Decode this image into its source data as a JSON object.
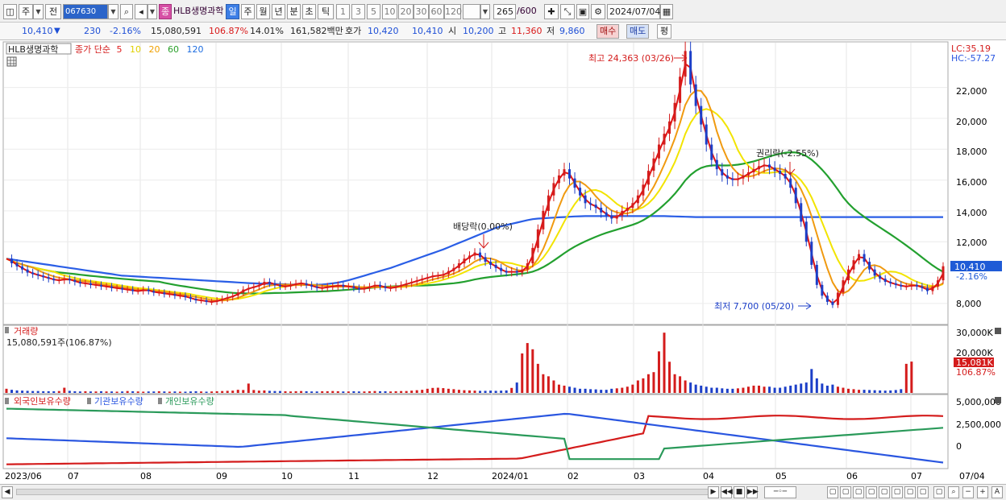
{
  "toolbar": {
    "period_btn": "주",
    "prev_btn": "전",
    "code": "067630",
    "badge": "종",
    "name": "HLB생명과학",
    "periods": [
      "일",
      "주",
      "월",
      "년",
      "분",
      "초",
      "틱"
    ],
    "active_period": "일",
    "intervals": [
      "1",
      "3",
      "5",
      "10",
      "20",
      "30",
      "60",
      "120"
    ],
    "count": "265",
    "count_total": "/600",
    "date": "2024/07/04"
  },
  "quote": {
    "price": "10,410",
    "arrow": "▼",
    "change": "230",
    "change_pct": "-2.16%",
    "volume": "15,080,591",
    "volume_ratio": "106.87%",
    "turnover": "14.01%",
    "amount": "161,582백만",
    "bid_label": "호가",
    "ask": "10,420",
    "bid": "10,410",
    "open_label": "시",
    "open": "10,200",
    "high_label": "고",
    "high": "11,360",
    "low_label": "저",
    "low": "9,860",
    "buy_btn": "매수",
    "sell_btn": "매도",
    "flat_btn": "평"
  },
  "legend": {
    "name": "HLB생명과학",
    "ma_title": "종가 단순",
    "ma": [
      {
        "label": "5",
        "color": "#e01c1c"
      },
      {
        "label": "10",
        "color": "#f0e000"
      },
      {
        "label": "20",
        "color": "#f0a000"
      },
      {
        "label": "60",
        "color": "#2aa02a"
      },
      {
        "label": "120",
        "color": "#1c6ce0"
      }
    ]
  },
  "annotations": {
    "high": "최고 24,363 (03/26)",
    "low": "최저 7,700 (05/20)",
    "dividend": "배당락(0.00%)",
    "rights": "권리락(-2.55%)"
  },
  "price_axis": {
    "ticks": [
      "22,000",
      "20,000",
      "18,000",
      "16,000",
      "14,000",
      "12,000",
      "8,000"
    ],
    "lc": "LC:35.19",
    "hc": "HC:-57.27",
    "current_price": "10,410",
    "current_pct": "-2.16%"
  },
  "volume_panel": {
    "title": "거래량",
    "info": "15,080,591주(106.87%)",
    "ticks": [
      "30,000K",
      "20,000K"
    ],
    "current": "15,081K",
    "current_pct": "106.87%"
  },
  "holdings_panel": {
    "series": [
      {
        "label": "외국인보유수량",
        "color": "#d41c1c"
      },
      {
        "label": "기관보유수량",
        "color": "#2a56e0"
      },
      {
        "label": "개인보유수량",
        "color": "#2a9a5a"
      }
    ],
    "ticks": [
      "5,000,000",
      "2,500,000",
      "0"
    ]
  },
  "time_axis": [
    "2023/06",
    "07",
    "08",
    "09",
    "10",
    "11",
    "12",
    "2024/01",
    "02",
    "03",
    "04",
    "05",
    "06",
    "07",
    "07/04"
  ],
  "chart_data": {
    "type": "candlestick",
    "ylim": [
      7000,
      24800
    ],
    "close": [
      10900,
      10600,
      10400,
      10200,
      10000,
      9900,
      9800,
      9700,
      9600,
      9500,
      9500,
      9600,
      9500,
      9400,
      9300,
      9300,
      9200,
      9200,
      9100,
      9100,
      9000,
      9000,
      8900,
      8900,
      8800,
      8800,
      8900,
      8800,
      8700,
      8700,
      8600,
      8600,
      8500,
      8500,
      8400,
      8300,
      8200,
      8200,
      8100,
      8100,
      8200,
      8300,
      8400,
      8500,
      8700,
      8900,
      9000,
      9100,
      9200,
      9400,
      9300,
      9200,
      9100,
      9100,
      9200,
      9300,
      9300,
      9200,
      9100,
      9000,
      9000,
      9100,
      9100,
      9200,
      9100,
      9100,
      9000,
      8900,
      9000,
      9100,
      9200,
      9100,
      9000,
      9000,
      9100,
      9200,
      9300,
      9400,
      9500,
      9600,
      9700,
      9800,
      9800,
      9900,
      10100,
      10300,
      10600,
      10900,
      11100,
      11300,
      11000,
      10700,
      10500,
      10300,
      10100,
      10000,
      10100,
      10000,
      10200,
      10600,
      11600,
      12800,
      14000,
      15000,
      15800,
      16300,
      16700,
      16100,
      15500,
      15000,
      14500,
      14400,
      14200,
      13900,
      13700,
      13500,
      13700,
      14000,
      14200,
      14500,
      15000,
      15700,
      16600,
      17400,
      18300,
      19000,
      19800,
      21000,
      22700,
      24363,
      22200,
      20800,
      19600,
      18300,
      17300,
      16700,
      16300,
      16100,
      16000,
      16100,
      16300,
      16500,
      16700,
      16900,
      17000,
      16800,
      16600,
      16400,
      16100,
      15500,
      14500,
      13300,
      12000,
      10500,
      9200,
      8500,
      8100,
      7900,
      8700,
      9500,
      10200,
      10800,
      11200,
      10700,
      10200,
      9800,
      9600,
      9400,
      9300,
      9200,
      9100,
      9100,
      9200,
      9100,
      9000,
      8800,
      9100,
      9500,
      10410
    ],
    "ma120": [
      10900,
      10850,
      10800,
      10750,
      10700,
      10650,
      10600,
      10550,
      10500,
      10450,
      10400,
      10350,
      10300,
      10250,
      10200,
      10150,
      10100,
      10050,
      10000,
      9950,
      9900,
      9850,
      9800,
      9780,
      9760,
      9740,
      9720,
      9700,
      9680,
      9660,
      9640,
      9620,
      9600,
      9580,
      9560,
      9540,
      9520,
      9500,
      9480,
      9460,
      9440,
      9420,
      9400,
      9380,
      9360,
      9340,
      9320,
      9300,
      9290,
      9280,
      9270,
      9260,
      9250,
      9240,
      9230,
      9220,
      9210,
      9200,
      9200,
      9210,
      9230,
      9260,
      9300,
      9350,
      9420,
      9500,
      9600,
      9700,
      9800,
      9900,
      10000,
      10100,
      10200,
      10300,
      10420,
      10540,
      10660,
      10780,
      10900,
      11020,
      11140,
      11260,
      11380,
      11500,
      11640,
      11780,
      11920,
      12060,
      12200,
      12340,
      12480,
      12620,
      12760,
      12900,
      13000,
      13080,
      13160,
      13240,
      13320,
      13400,
      13460,
      13500,
      13520,
      13540,
      13560,
      13580,
      13600,
      13620,
      13640,
      13650,
      13660,
      13660,
      13660,
      13660,
      13660,
      13660,
      13660,
      13660,
      13660,
      13660,
      13660,
      13660,
      13660,
      13660,
      13660,
      13660,
      13650,
      13640,
      13630,
      13620,
      13610,
      13600,
      13600,
      13600,
      13600,
      13600,
      13600,
      13600,
      13600,
      13600,
      13600,
      13600,
      13600,
      13600,
      13600,
      13600,
      13600,
      13600,
      13600,
      13600,
      13600,
      13600,
      13600,
      13600,
      13600,
      13600,
      13600,
      13600,
      13600,
      13600,
      13600,
      13600,
      13600,
      13600,
      13600,
      13600,
      13600,
      13600,
      13600,
      13600,
      13600,
      13600,
      13600,
      13600,
      13600,
      13600,
      13600,
      13600,
      13600
    ],
    "volume_k": [
      2000,
      1500,
      1200,
      1100,
      1000,
      900,
      900,
      800,
      800,
      800,
      900,
      2500,
      1000,
      800,
      700,
      800,
      700,
      700,
      800,
      700,
      700,
      600,
      700,
      900,
      800,
      700,
      600,
      700,
      700,
      800,
      700,
      600,
      700,
      600,
      600,
      700,
      800,
      700,
      600,
      700,
      800,
      900,
      1000,
      1100,
      1500,
      1400,
      4500,
      1400,
      1100,
      1200,
      1000,
      900,
      900,
      800,
      700,
      800,
      900,
      800,
      700,
      700,
      800,
      800,
      900,
      800,
      700,
      700,
      800,
      700,
      700,
      800,
      900,
      800,
      800,
      700,
      800,
      900,
      900,
      1100,
      1300,
      1500,
      2000,
      2400,
      2500,
      2300,
      2000,
      1800,
      1500,
      1300,
      1200,
      1100,
      1000,
      1000,
      1100,
      1000,
      1100,
      1200,
      2400,
      5000,
      19000,
      24000,
      21000,
      14000,
      9000,
      8000,
      6000,
      4000,
      3500,
      3000,
      2500,
      2000,
      2000,
      1800,
      1700,
      1500,
      1500,
      2000,
      2200,
      2500,
      3000,
      4000,
      6000,
      7000,
      9000,
      10000,
      20000,
      29000,
      15000,
      9000,
      8000,
      6000,
      5000,
      4000,
      3500,
      3000,
      2500,
      2500,
      2200,
      2000,
      2000,
      2200,
      2500,
      3000,
      3500,
      3500,
      3000,
      3000,
      2500,
      2500,
      3000,
      3500,
      4000,
      4500,
      5000,
      11500,
      7000,
      4500,
      3500,
      4000,
      3000,
      2500,
      2000,
      1800,
      1500,
      1500,
      1400,
      1300,
      1200,
      1100,
      1200,
      1400,
      1800,
      14000,
      15081
    ]
  }
}
